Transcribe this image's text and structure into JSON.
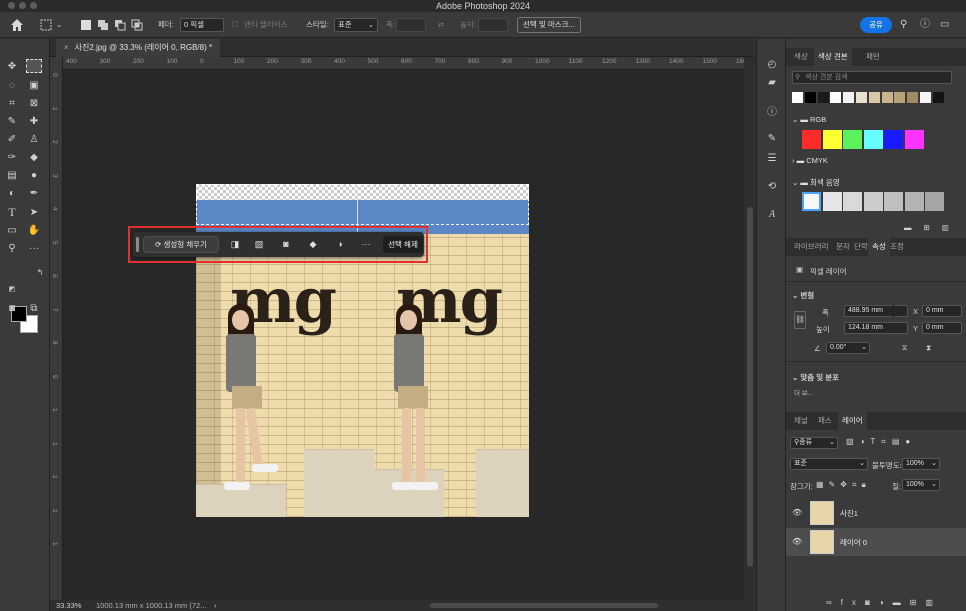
{
  "app": {
    "window_title": "Adobe Photoshop 2024"
  },
  "options_bar": {
    "feather_label": "페더:",
    "feather_value": "0 픽셀",
    "antialias_label": "앤티 앨리어스",
    "style_label": "스타일:",
    "style_value": "표준",
    "width_label": "폭:",
    "height_label": "높이:",
    "select_mask_button": "선택 및 마스크...",
    "share_button": "공유"
  },
  "document": {
    "tab_close": "×",
    "tab_title": "사진2.jpg @ 33.3% (레이어 0, RGB/8) *",
    "ruler_h": [
      "400",
      "300",
      "200",
      "100",
      "0",
      "100",
      "200",
      "300",
      "400",
      "500",
      "600",
      "700",
      "800",
      "900",
      "1000",
      "1100",
      "1200",
      "1300",
      "1400",
      "1500",
      "1600"
    ],
    "ruler_v": [
      "0",
      "1",
      "2",
      "3",
      "4",
      "5",
      "6",
      "7",
      "8",
      "9",
      "1",
      "1",
      "1",
      "1",
      "1"
    ],
    "photo_logo_text": "mg",
    "zoom": "33.33%",
    "dimensions": "1000.13 mm x 1000.13 mm (72...",
    "status_arrow": "›"
  },
  "taskbar": {
    "generative_fill": "생성형 채우기",
    "more": "···",
    "deselect": "선택 해제"
  },
  "swatches_panel": {
    "tabs": [
      "색상",
      "색상 견본",
      "패턴"
    ],
    "search_placeholder": "색상 견본 검색",
    "recent_colors": [
      "#ffffff",
      "#000000",
      "#1a1a1a",
      "#ffffff",
      "#f2f2f2",
      "#e9e0cf",
      "#d8c8a8",
      "#c9b48c",
      "#b8a27a",
      "#a08a64",
      "#f5f5f5",
      "#141414"
    ],
    "groups": [
      {
        "name": "RGB",
        "colors": [
          "#ff2a2a",
          "#ffff33",
          "#5cf25c",
          "#66ffff",
          "#1a1aff",
          "#ff33ff"
        ]
      },
      {
        "name": "CMYK",
        "colors": []
      },
      {
        "name": "회색 음영",
        "colors": [
          "#f7f7f7",
          "#e6e6e6",
          "#d9d9d9",
          "#cccccc",
          "#bfbfbf",
          "#b3b3b3",
          "#a6a6a6"
        ]
      }
    ]
  },
  "properties_panel": {
    "tabs": [
      "라이브러리",
      "문자",
      "단락",
      "속성",
      "조정"
    ],
    "layer_type": "픽셀 레이어",
    "transform_label": "변형",
    "width_label": "폭",
    "width_value": "488.95 mm",
    "x_label": "X",
    "x_value": "0 mm",
    "height_label": "높이",
    "height_value": "124.18 mm",
    "y_label": "Y",
    "y_value": "0 mm",
    "angle_value": "0.00°",
    "align_label": "맞춤 및 분포",
    "more": "더 보..."
  },
  "layers_panel": {
    "tabs": [
      "채널",
      "패스",
      "레이어"
    ],
    "filter_label": "종류",
    "blend_mode": "표준",
    "opacity_label": "불투명도:",
    "opacity_value": "100%",
    "lock_label": "잠그기:",
    "fill_label": "칠:",
    "fill_value": "100%",
    "layers": [
      {
        "name": "사진1",
        "selected": false
      },
      {
        "name": "레이어 0",
        "selected": true
      }
    ]
  }
}
